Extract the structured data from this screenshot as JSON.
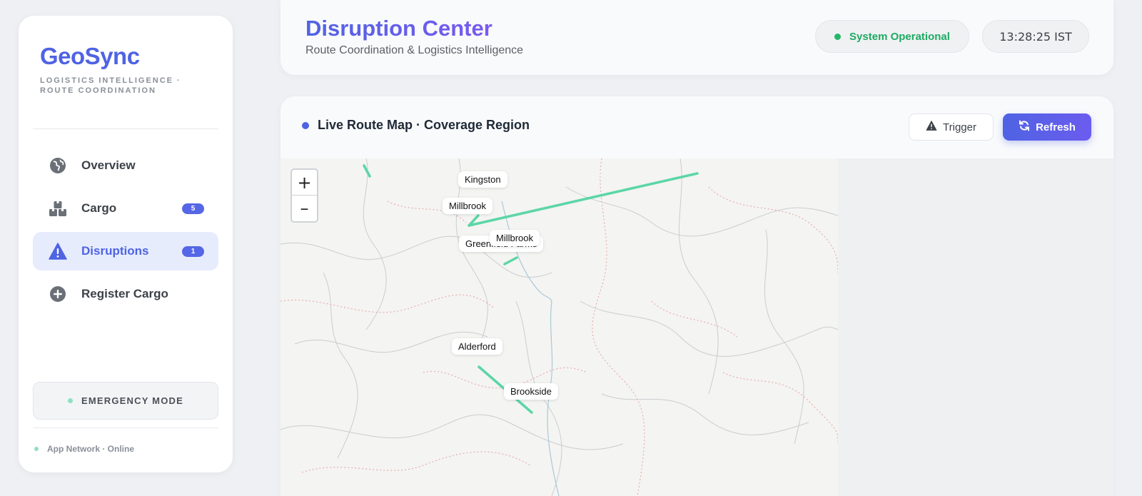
{
  "brand": {
    "title": "GeoSync",
    "subtitle": "LOGISTICS INTELLIGENCE · ROUTE COORDINATION"
  },
  "nav": [
    {
      "label": "Overview",
      "icon": "globe-icon",
      "badge": null,
      "active": false
    },
    {
      "label": "Cargo",
      "icon": "boxes-icon",
      "badge": "5",
      "active": false
    },
    {
      "label": "Disruptions",
      "icon": "warning-icon",
      "badge": "1",
      "active": true
    },
    {
      "label": "Register Cargo",
      "icon": "plus-circle-icon",
      "badge": null,
      "active": false
    }
  ],
  "emergency": {
    "label": "EMERGENCY MODE"
  },
  "network": {
    "label": "App Network · Online"
  },
  "header": {
    "title": "Disruption Center",
    "subtitle": "Route Coordination & Logistics Intelligence",
    "status": "System Operational",
    "clock": "13:28:25 IST"
  },
  "map": {
    "title": "Live Route Map · Coverage Region",
    "trigger_label": "Trigger",
    "refresh_label": "Refresh",
    "zoom_in": "+",
    "zoom_out": "–",
    "cities": [
      "Kingston",
      "Millbrook",
      "Greenfield Farms",
      "Millbrook",
      "Alderford",
      "Brookside"
    ],
    "route_color": "#5cd6a6"
  },
  "colors": {
    "accent": "#4f63e3",
    "success": "#22b86a",
    "route": "#5cd6a6"
  }
}
